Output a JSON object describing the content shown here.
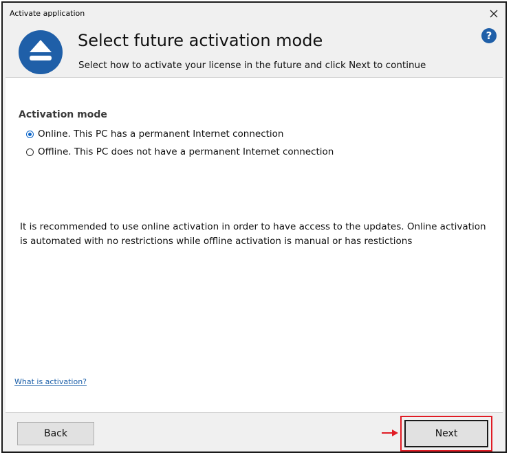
{
  "window": {
    "title": "Activate application",
    "close_symbol": "✕"
  },
  "header": {
    "title": "Select future activation mode",
    "subtitle": "Select how to activate your license in the future and click Next to continue",
    "logo_icon": "upload-logo-icon",
    "help_icon": "help-icon",
    "help_symbol": "?"
  },
  "activation": {
    "section_label": "Activation mode",
    "options": [
      {
        "label": "Online. This PC has a permanent Internet connection",
        "selected": true
      },
      {
        "label": "Offline. This PC does not have a permanent Internet connection",
        "selected": false
      }
    ]
  },
  "info": {
    "text": "It is recommended to use online activation in order to have access to the updates. Online activation is automated with no restrictions while offline activation is manual or has restictions"
  },
  "links": {
    "what_is_activation": "What is activation?"
  },
  "footer": {
    "back_label": "Back",
    "next_label": "Next"
  },
  "colors": {
    "logo_blue": "#1f5fa8",
    "highlight_red": "#e01b24",
    "link_blue": "#1a5ea8"
  }
}
